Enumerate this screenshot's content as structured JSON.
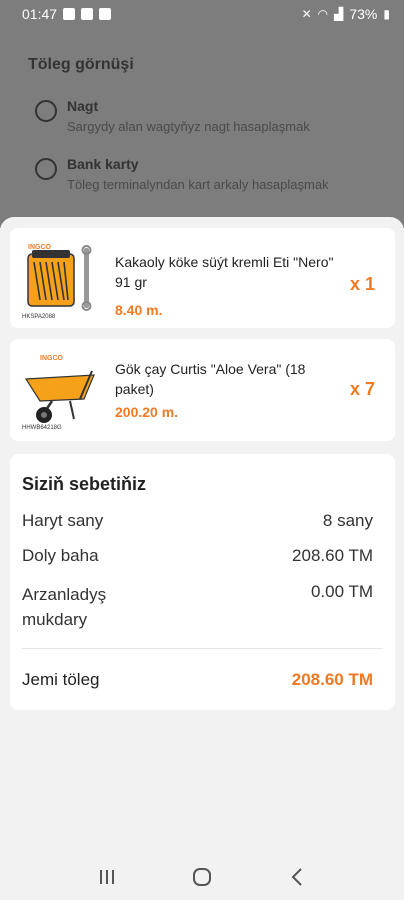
{
  "status": {
    "time": "01:47",
    "battery": "73%"
  },
  "payment": {
    "title": "Töleg görnüşi",
    "options": [
      {
        "title": "Nagt",
        "subtitle": "Sargydy alan wagtyňyz nagt hasaplaşmak"
      },
      {
        "title": "Bank karty",
        "subtitle": "Töleg terminalyndan kart arkaly hasaplaşmak"
      }
    ]
  },
  "cart_items": [
    {
      "name": "Kakaoly köke süýt kremli Eti \"Nero\" 91 gr",
      "price": "8.40 m.",
      "qty": "x 1",
      "image_brand": "INGCO",
      "image_code": "HKSPA2088"
    },
    {
      "name": "Gök çay Curtis \"Aloe Vera\" (18 paket)",
      "price": "200.20 m.",
      "qty": "x 7",
      "image_brand": "INGCO",
      "image_code": "HHWB64218G"
    }
  ],
  "summary": {
    "title": "Siziň sebetiňiz",
    "rows": [
      {
        "label": "Haryt sany",
        "value": "8 sany"
      },
      {
        "label": "Doly baha",
        "value": "208.60 TM"
      },
      {
        "label": "Arzanladyş mukdary",
        "value": "0.00 TM"
      }
    ],
    "total_label": "Jemi töleg",
    "total_value": "208.60 TM"
  },
  "colors": {
    "accent": "#f07a24",
    "dim": "#7d7d7d",
    "sheet_bg": "#f2f2f2"
  },
  "nav": {
    "icons": [
      "recents-icon",
      "home-icon",
      "back-icon"
    ]
  }
}
